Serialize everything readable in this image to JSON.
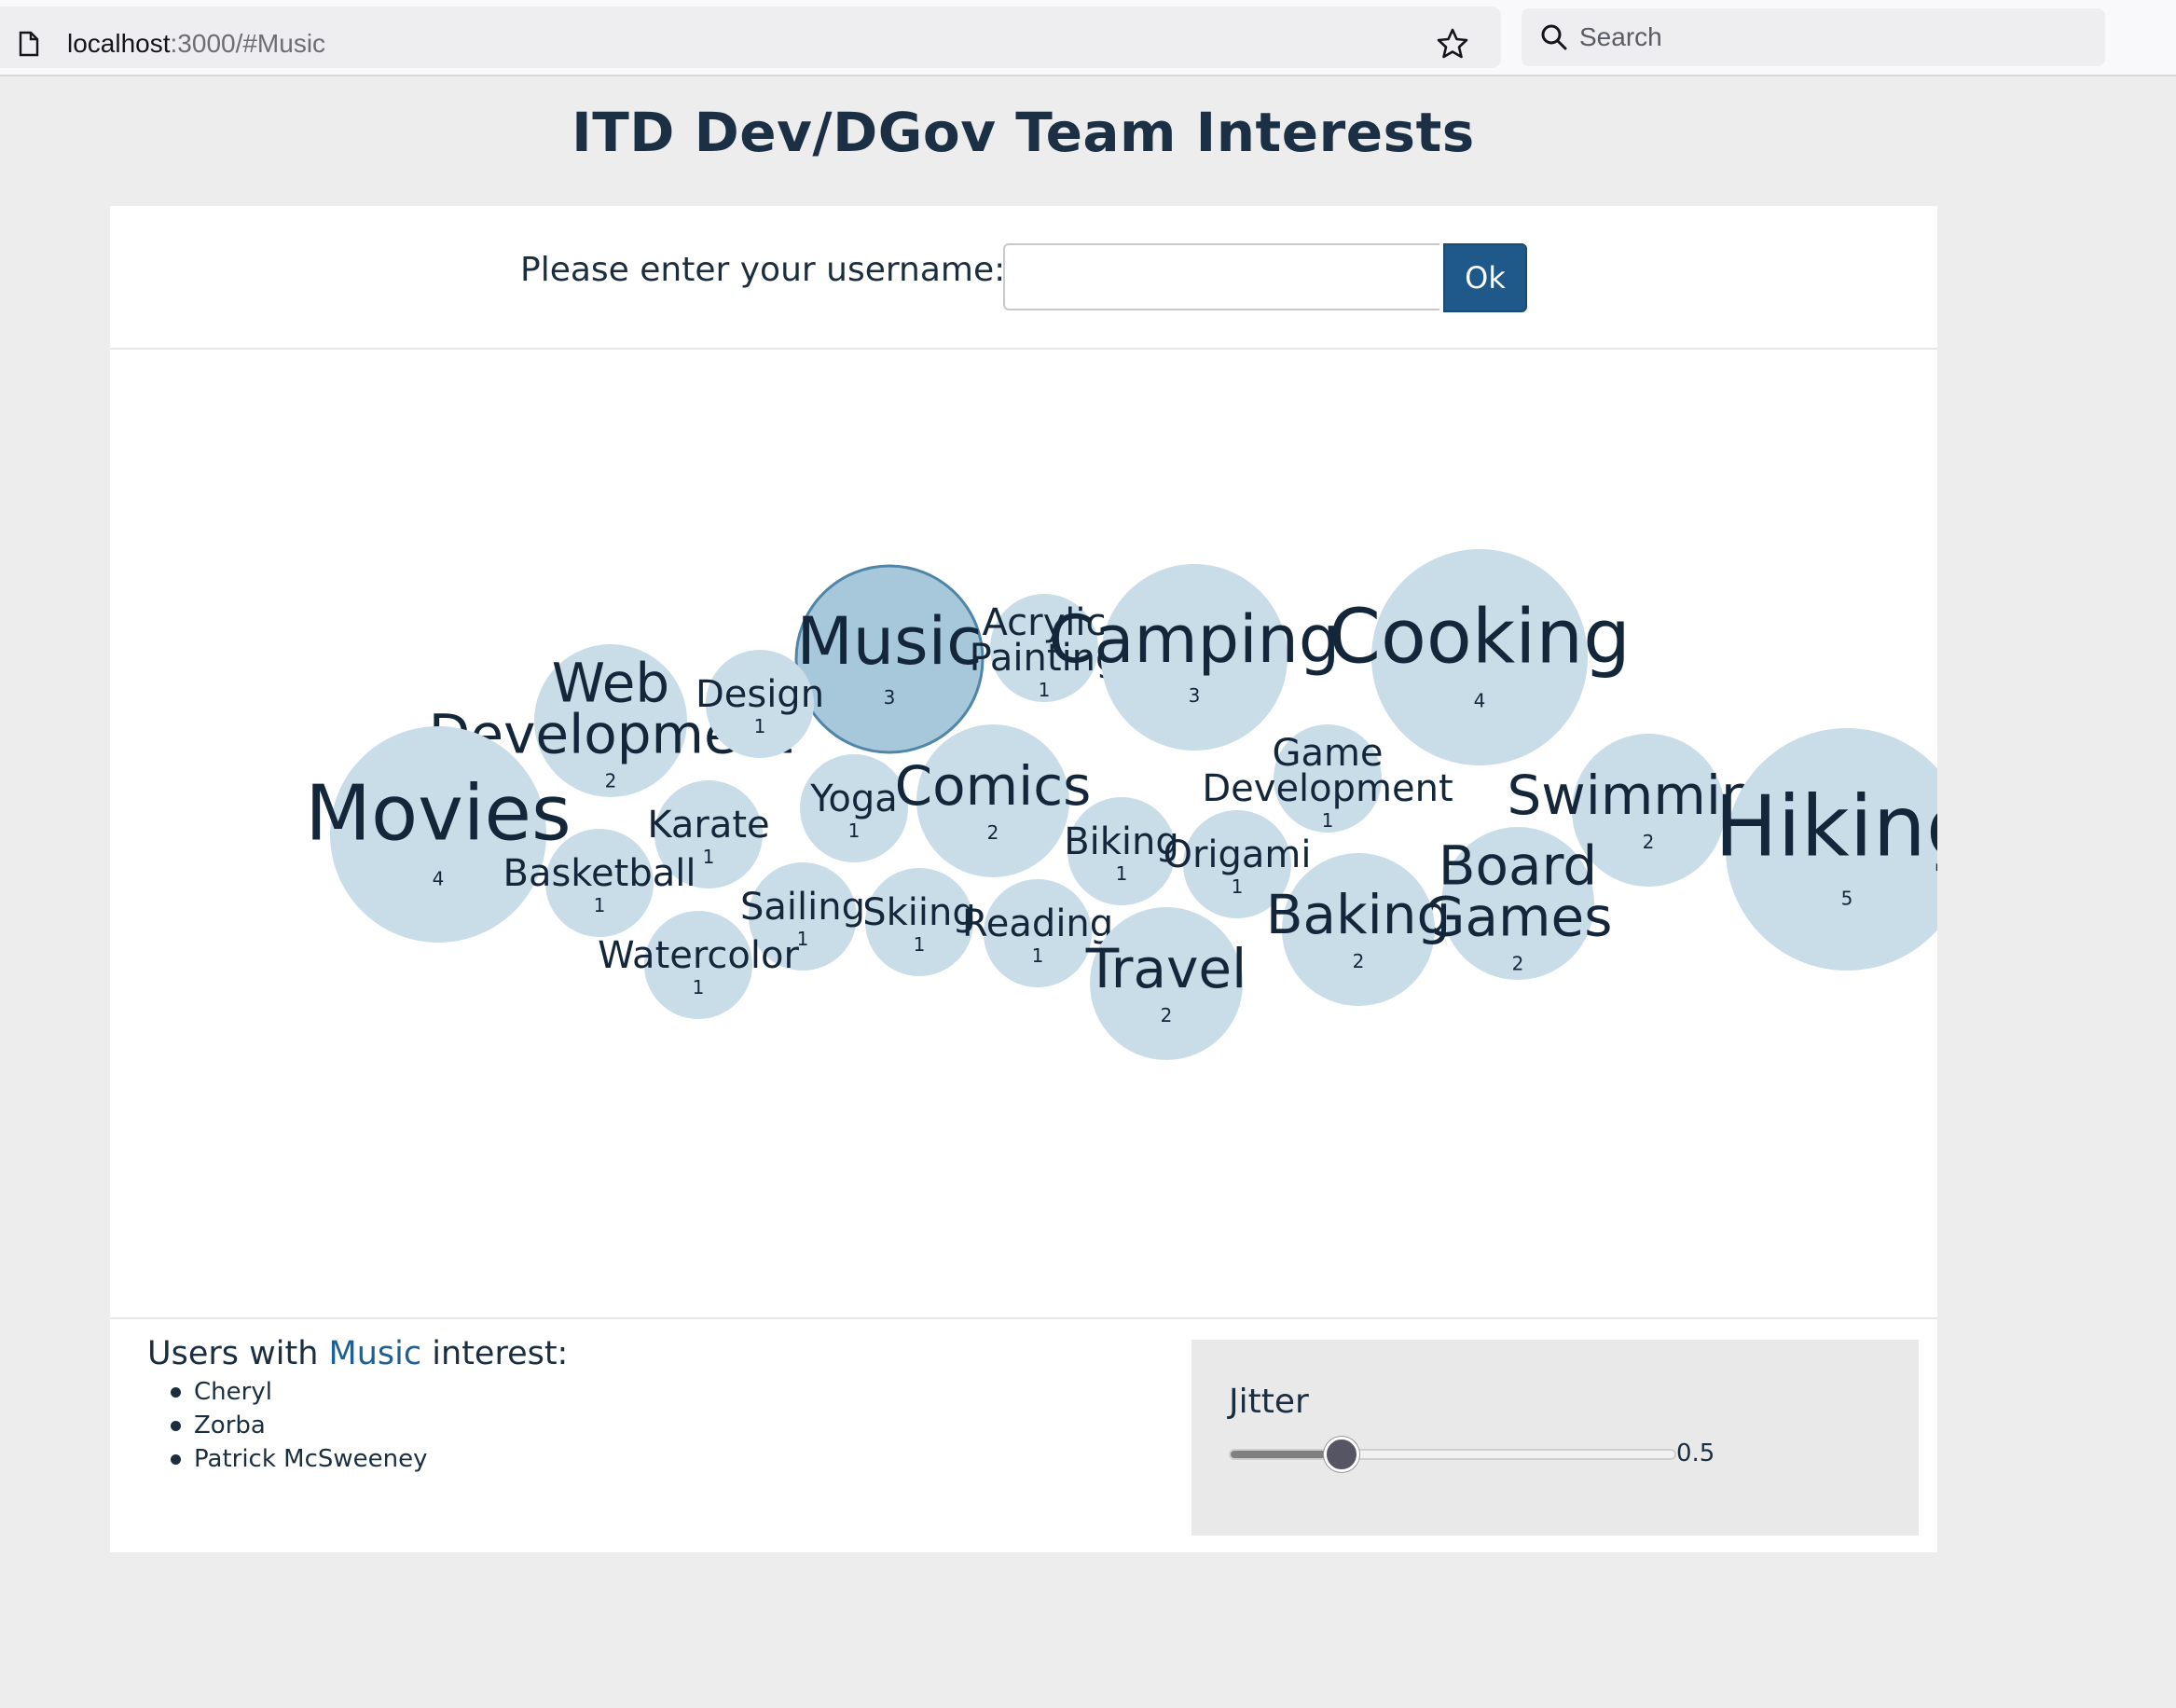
{
  "browser": {
    "url_host": "localhost",
    "url_rest": ":3000/#Music",
    "search_placeholder": "Search"
  },
  "page": {
    "title": "ITD Dev/DGov Team Interests"
  },
  "login": {
    "label": "Please enter your username:",
    "username_value": "",
    "ok_label": "Ok"
  },
  "bubbles": [
    {
      "id": "music",
      "lines": [
        "Music"
      ],
      "count": "3",
      "selected": true
    },
    {
      "id": "acrylic-painting",
      "lines": [
        "Acrylic",
        "Painting"
      ],
      "count": "1"
    },
    {
      "id": "camping",
      "lines": [
        "Camping"
      ],
      "count": "3"
    },
    {
      "id": "cooking",
      "lines": [
        "Cooking"
      ],
      "count": "4"
    },
    {
      "id": "web-development",
      "lines": [
        "Web",
        "Development"
      ],
      "count": "2"
    },
    {
      "id": "design",
      "lines": [
        "Design"
      ],
      "count": "1"
    },
    {
      "id": "movies",
      "lines": [
        "Movies"
      ],
      "count": "4"
    },
    {
      "id": "yoga",
      "lines": [
        "Yoga"
      ],
      "count": "1"
    },
    {
      "id": "comics",
      "lines": [
        "Comics"
      ],
      "count": "2"
    },
    {
      "id": "game-development",
      "lines": [
        "Game",
        "Development"
      ],
      "count": "1"
    },
    {
      "id": "swimming",
      "lines": [
        "Swimming"
      ],
      "count": "2"
    },
    {
      "id": "hiking",
      "lines": [
        "Hiking"
      ],
      "count": "5"
    },
    {
      "id": "karate",
      "lines": [
        "Karate"
      ],
      "count": "1"
    },
    {
      "id": "biking",
      "lines": [
        "Biking"
      ],
      "count": "1"
    },
    {
      "id": "origami",
      "lines": [
        "Origami"
      ],
      "count": "1"
    },
    {
      "id": "board-games",
      "lines": [
        "Board",
        "Games"
      ],
      "count": "2"
    },
    {
      "id": "basketball",
      "lines": [
        "Basketball"
      ],
      "count": "1"
    },
    {
      "id": "sailing",
      "lines": [
        "Sailing"
      ],
      "count": "1"
    },
    {
      "id": "skiing",
      "lines": [
        "Skiing"
      ],
      "count": "1"
    },
    {
      "id": "reading",
      "lines": [
        "Reading"
      ],
      "count": "1"
    },
    {
      "id": "baking",
      "lines": [
        "Baking"
      ],
      "count": "2"
    },
    {
      "id": "watercolor",
      "lines": [
        "Watercolor"
      ],
      "count": "1"
    },
    {
      "id": "travel",
      "lines": [
        "Travel"
      ],
      "count": "2"
    }
  ],
  "users_panel": {
    "prefix": "Users with",
    "interest": "Music",
    "suffix": "interest:",
    "users": [
      "Cheryl",
      "Zorba",
      "Patrick McSweeney"
    ]
  },
  "jitter": {
    "label": "Jitter",
    "value": 0.5,
    "value_label": "0.5",
    "min": 0,
    "max": 2
  }
}
